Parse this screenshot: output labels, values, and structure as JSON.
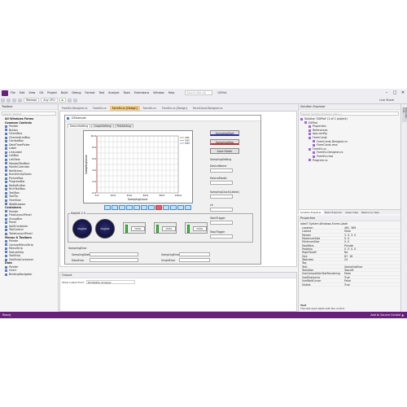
{
  "app": {
    "name": "DXPad"
  },
  "menu": [
    "File",
    "Edit",
    "View",
    "Git",
    "Project",
    "Build",
    "Debug",
    "Format",
    "Test",
    "Analyze",
    "Tools",
    "Extensions",
    "Window",
    "Help"
  ],
  "search": {
    "placeholder": "Search (Ctrl+Q)"
  },
  "window_controls": [
    "–",
    "□",
    "✕"
  ],
  "toolbar": {
    "config": "Release",
    "platform": "Any CPU",
    "run": "▶",
    "live_share": "Live Share"
  },
  "toolbox": {
    "title": "Toolbox",
    "search_placeholder": "Search Toolbox",
    "items": [
      {
        "label": "All Windows Forms",
        "cat": true
      },
      {
        "label": "Common Controls",
        "cat": true
      },
      {
        "label": "Pointer"
      },
      {
        "label": "Button"
      },
      {
        "label": "CheckBox"
      },
      {
        "label": "CheckedListBox"
      },
      {
        "label": "ComboBox"
      },
      {
        "label": "DateTimePicker"
      },
      {
        "label": "Label"
      },
      {
        "label": "LinkLabel"
      },
      {
        "label": "ListBox"
      },
      {
        "label": "ListView"
      },
      {
        "label": "MaskedTextBox"
      },
      {
        "label": "MonthCalendar"
      },
      {
        "label": "NotifyIcon"
      },
      {
        "label": "NumericUpDown"
      },
      {
        "label": "PictureBox"
      },
      {
        "label": "ProgressBar"
      },
      {
        "label": "RadioButton"
      },
      {
        "label": "RichTextBox"
      },
      {
        "label": "TextBox"
      },
      {
        "label": "ToolTip"
      },
      {
        "label": "TreeView"
      },
      {
        "label": "WebBrowser"
      },
      {
        "label": "Containers",
        "cat": true
      },
      {
        "label": "Pointer"
      },
      {
        "label": "FlowLayoutPanel"
      },
      {
        "label": "GroupBox"
      },
      {
        "label": "Panel"
      },
      {
        "label": "SplitContainer"
      },
      {
        "label": "TabControl"
      },
      {
        "label": "TableLayoutPanel"
      },
      {
        "label": "Menus & Toolbars",
        "cat": true
      },
      {
        "label": "Pointer"
      },
      {
        "label": "ContextMenuStrip"
      },
      {
        "label": "MenuStrip"
      },
      {
        "label": "StatusStrip"
      },
      {
        "label": "ToolStrip"
      },
      {
        "label": "ToolStripContainer"
      },
      {
        "label": "Data",
        "cat": true
      },
      {
        "label": "Pointer"
      },
      {
        "label": "Chart"
      },
      {
        "label": "BindingNavigator"
      }
    ]
  },
  "doc_tabs": [
    {
      "label": "FormEx.Designer.cs",
      "active": false
    },
    {
      "label": "FormEx.cs",
      "active": false
    },
    {
      "label": "FormEx.cs [Design]",
      "active": true
    },
    {
      "label": "FormEx.cs",
      "active": false
    },
    {
      "label": "FormEx.cs [Design]",
      "active": false
    },
    {
      "label": "FormConst.Designer.cs",
      "active": false
    }
  ],
  "form": {
    "title": "DXSample",
    "tabs": [
      "DeviceSetting",
      "GraphSetting",
      "PlotSetting"
    ],
    "group_title": "DegSet 2.0",
    "circle_label": "DegSet",
    "panel_labels": [
      "DOOL",
      "DOOL",
      "DOOL"
    ],
    "sampling_error": "SamplingError",
    "fields_left": [
      "SamplingStatus",
      "DataError"
    ],
    "fields_right": [
      "SamplingError",
      "GraphError"
    ],
    "right_buttons": [
      "SamplingStart",
      "SamplingStop",
      "Save Folder"
    ],
    "right_labels": [
      "SamplingSetting",
      "DeviceName",
      "DeviceModel",
      "SamplingClock(Latest)",
      "ch",
      "StartTrigger",
      "StopTrigger"
    ]
  },
  "chart_data": {
    "type": "line",
    "xlabel": "SamplingCount",
    "ylabel": "SamplingValue",
    "xlim": [
      0,
      100
    ],
    "ylim": [
      0,
      10
    ],
    "x_ticks": [
      "0.0",
      "20.0",
      "40.0",
      "60.0",
      "80.0",
      "100.0"
    ],
    "y_ticks": [
      "10.0",
      "8.0",
      "6.0",
      "4.0",
      "2.0",
      "0.0"
    ],
    "series": [
      {
        "name": "CH1",
        "color": "#c04040",
        "x": [
          0,
          0
        ],
        "y": [
          0,
          10
        ]
      },
      {
        "name": "CH2",
        "color": "#5a8a3c",
        "x": [],
        "y": []
      },
      {
        "name": "CH3",
        "color": "#4a6fc4",
        "x": [],
        "y": []
      }
    ],
    "legend": "top-right",
    "grid": true
  },
  "output": {
    "title": "Output",
    "show_from": "Show output from:",
    "source": "Portability Analysis"
  },
  "solution_explorer": {
    "title": "Solution Explorer",
    "search_placeholder": "Search Solution Explorer (Ctrl+;)",
    "items": [
      {
        "label": "Solution 'DXPad' (1 of 1 project)",
        "level": 0
      },
      {
        "label": "DXPad",
        "level": 1
      },
      {
        "label": "Properties",
        "level": 2
      },
      {
        "label": "References",
        "level": 2
      },
      {
        "label": "App.config",
        "level": 2
      },
      {
        "label": "FormConst",
        "level": 2
      },
      {
        "label": "FormConst.Designer.cs",
        "level": 3
      },
      {
        "label": "FormConst.resx",
        "level": 3
      },
      {
        "label": "FormEx.cs",
        "level": 2
      },
      {
        "label": "FormEx.Designer.cs",
        "level": 3
      },
      {
        "label": "FormEx.resx",
        "level": 3
      },
      {
        "label": "Program.cs",
        "level": 2
      }
    ],
    "tabs": [
      "Solution Explorer",
      "Team Explorer",
      "Class View",
      "Resource View"
    ]
  },
  "properties": {
    "title": "Properties",
    "object": "label7 System.Windows.Forms.Label",
    "rows": [
      {
        "name": "Location",
        "value": "461, 369"
      },
      {
        "name": "Locked",
        "value": "False"
      },
      {
        "name": "Margin",
        "value": "3, 0, 3, 0"
      },
      {
        "name": "MaximumSize",
        "value": "0, 0"
      },
      {
        "name": "MinimumSize",
        "value": "0, 0"
      },
      {
        "name": "Modifiers",
        "value": "Private"
      },
      {
        "name": "Padding",
        "value": "0, 0, 0, 0"
      },
      {
        "name": "RightToLeft",
        "value": "No"
      },
      {
        "name": "Size",
        "value": "87, 18"
      },
      {
        "name": "TabIndex",
        "value": "24"
      },
      {
        "name": "Tag",
        "value": ""
      },
      {
        "name": "Text",
        "value": "SamplingError"
      },
      {
        "name": "TextAlign",
        "value": "TopLeft"
      },
      {
        "name": "UseCompatibleTextRendering",
        "value": "False"
      },
      {
        "name": "UseMnemonic",
        "value": "True"
      },
      {
        "name": "UseWaitCursor",
        "value": "False"
      },
      {
        "name": "Visible",
        "value": "True"
      }
    ],
    "desc_title": "Text",
    "desc_text": "The text associated with the control."
  },
  "right_strip": "Diagnostic Tools",
  "statusbar": {
    "left": "Ready",
    "right": "Add to Source Control ▲"
  }
}
